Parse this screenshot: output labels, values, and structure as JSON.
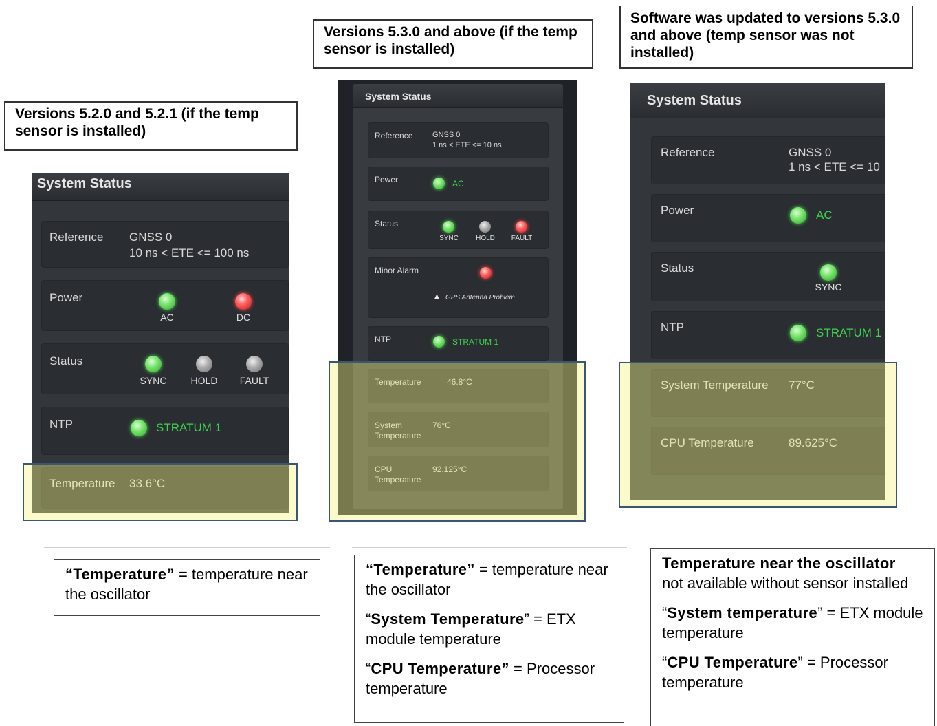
{
  "callouts": {
    "left": "Versions 5.2.0 and 5.2.1 (if the temp sensor is installed)",
    "middle": "Versions 5.3.0 and above (if the temp sensor is installed)",
    "right": "Software was updated to versions 5.3.0 and above (temp sensor was not installed)"
  },
  "panel_left": {
    "title": "System Status",
    "reference_label": "Reference",
    "reference_line1": "GNSS 0",
    "reference_line2": "10 ns < ETE <= 100 ns",
    "power_label": "Power",
    "power_leds": [
      {
        "label": "AC",
        "color": "green"
      },
      {
        "label": "DC",
        "color": "red"
      }
    ],
    "status_label": "Status",
    "status_leds": [
      {
        "label": "SYNC",
        "color": "green"
      },
      {
        "label": "HOLD",
        "color": "gray"
      },
      {
        "label": "FAULT",
        "color": "gray"
      }
    ],
    "ntp_label": "NTP",
    "ntp_value": "STRATUM 1",
    "temperature_label": "Temperature",
    "temperature_value": "33.6°C"
  },
  "panel_middle": {
    "title": "System Status",
    "reference_label": "Reference",
    "reference_line1": "GNSS 0",
    "reference_line2": "1 ns < ETE <= 10 ns",
    "power_label": "Power",
    "power_value": "AC",
    "status_label": "Status",
    "status_leds": [
      {
        "label": "SYNC",
        "color": "green"
      },
      {
        "label": "HOLD",
        "color": "gray"
      },
      {
        "label": "FAULT",
        "color": "red"
      }
    ],
    "minor_alarm_label": "Minor Alarm",
    "minor_alarm_text": "GPS Antenna Problem",
    "ntp_label": "NTP",
    "ntp_value": "STRATUM 1",
    "temperature_label": "Temperature",
    "temperature_value": "46.8°C",
    "system_temp_label_1": "System",
    "system_temp_label_2": "Temperature",
    "system_temp_value": "76°C",
    "cpu_temp_label_1": "CPU",
    "cpu_temp_label_2": "Temperature",
    "cpu_temp_value": "92.125°C"
  },
  "panel_right": {
    "title": "System Status",
    "reference_label": "Reference",
    "reference_line1": "GNSS 0",
    "reference_line2": "1 ns < ETE <= 10",
    "power_label": "Power",
    "power_value": "AC",
    "status_label": "Status",
    "status_led_label": "SYNC",
    "ntp_label": "NTP",
    "ntp_value": "STRATUM 1",
    "system_temp_label": "System Temperature",
    "system_temp_value": "77°C",
    "cpu_temp_label": "CPU Temperature",
    "cpu_temp_value": "89.625°C"
  },
  "notes": {
    "left": {
      "term": "“Temperature”",
      "def": " = temperature near the oscillator"
    },
    "middle": [
      {
        "term": "“Temperature”",
        "def": " = temperature near the oscillator"
      },
      {
        "open": "“",
        "term": "System Temperature",
        "close": "”",
        "def": " = ETX module temperature"
      },
      {
        "open": "“",
        "term": "CPU Temperature”",
        "def": " = Processor temperature"
      }
    ],
    "right": {
      "heading": "Temperature near the oscillator",
      "heading_def": "not available without sensor installed",
      "items": [
        {
          "open": "“",
          "term": "System temperature",
          "close": "”",
          "def": " = ETX module temperature"
        },
        {
          "open": "“",
          "term": "CPU Temperature",
          "close": "”",
          "def": " = Processor temperature"
        }
      ]
    }
  }
}
